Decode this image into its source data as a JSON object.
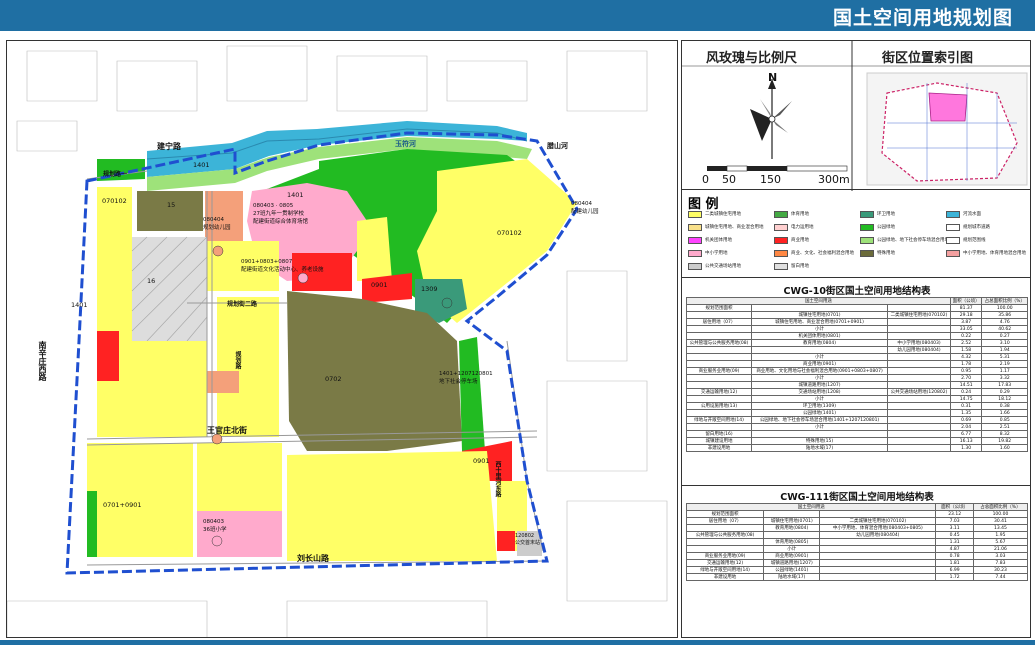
{
  "header": {
    "title": "国土空间用地规划图"
  },
  "panel": {
    "compass_title": "风玫瑰与比例尺",
    "index_title": "街区位置索引图",
    "north": "N",
    "scale_ticks": [
      "0",
      "50",
      "150",
      "300m"
    ],
    "legend_title": "图 例"
  },
  "legend": [
    {
      "label": "二类城镇住宅用地",
      "color": "#ffff66"
    },
    {
      "label": "体育用地",
      "color": "#44aa44"
    },
    {
      "label": "环卫用地",
      "color": "#3a9a7a"
    },
    {
      "label": "河流水面",
      "color": "#3cb4d8"
    },
    {
      "label": "城镇住宅用地、商业混合用地",
      "color": "#f8e08a"
    },
    {
      "label": "电力运用地",
      "color": "#ffd0d0"
    },
    {
      "label": "公园绿地",
      "color": "#22bb22"
    },
    {
      "label": "规划城市道路",
      "color": "#ffffff"
    },
    {
      "label": "机关团体用地",
      "color": "#ff44ff"
    },
    {
      "label": "商业用地",
      "color": "#ff2222"
    },
    {
      "label": "公园绿地、地下社会停车场混合用地",
      "color": "#9ee27a"
    },
    {
      "label": "规划范围线",
      "color": "#ffffff"
    },
    {
      "label": "中小学用地",
      "color": "#ffaacc"
    },
    {
      "label": "商业、文化、社会福利混合用地",
      "color": "#ff8844"
    },
    {
      "label": "特殊用地",
      "color": "#6b6b3a"
    },
    {
      "label": "中小学用地、体育用地混合用地",
      "color": "#f4a0a0"
    },
    {
      "label": "公共交通场站用地",
      "color": "#cccccc"
    },
    {
      "label": "留白用地",
      "color": "#e0e0e0"
    }
  ],
  "table1": {
    "title": "CWG-10街区国土空间用地结构表",
    "headers": [
      "国土空间用途",
      "面积（公顷）",
      "占总面积比例（%）"
    ],
    "rows": [
      [
        "规划范围面积",
        "",
        "",
        "81.37",
        "100.00"
      ],
      [
        "",
        "城镇住宅用地(0701)",
        "二类城镇住宅用地(070102)",
        "29.18",
        "35.86"
      ],
      [
        "居住用地（07）",
        "城镇住宅用地、商业混合用地(0701+0901)",
        "",
        "3.87",
        "4.76"
      ],
      [
        "",
        "小计",
        "",
        "33.05",
        "40.62"
      ],
      [
        "",
        "机关团体用地(0801)",
        "",
        "0.22",
        "0.27"
      ],
      [
        "公共管理与公共服务用地(08)",
        "教育用地(0804)",
        "中小学用地(080403)",
        "2.52",
        "3.10"
      ],
      [
        "",
        "",
        "幼儿园用地(080404)",
        "1.58",
        "1.94"
      ],
      [
        "",
        "小计",
        "",
        "4.32",
        "5.31"
      ],
      [
        "",
        "商业用地(0901)",
        "",
        "1.78",
        "2.19"
      ],
      [
        "商业服务业用地(09)",
        "商业用地、文化用地与社会福利混合用地(0901+0803+0807)",
        "",
        "0.95",
        "1.17"
      ],
      [
        "",
        "小计",
        "",
        "2.70",
        "3.32"
      ],
      [
        "",
        "城镇道路用地(1207)",
        "",
        "14.51",
        "17.83"
      ],
      [
        "交通运输用地(12)",
        "交通场站用地(1208)",
        "公共交通场站用地(120802)",
        "0.24",
        "0.29"
      ],
      [
        "",
        "小计",
        "",
        "14.75",
        "18.12"
      ],
      [
        "公用设施用地(13)",
        "环卫用地(1309)",
        "",
        "0.31",
        "0.38"
      ],
      [
        "",
        "公园绿地(1401)",
        "",
        "1.35",
        "1.66"
      ],
      [
        "绿地与开敞空间用地(14)",
        "公园绿地、地下社会停车场混合用地(1401+1207120801)",
        "",
        "0.69",
        "0.85"
      ],
      [
        "",
        "小计",
        "",
        "2.04",
        "2.51"
      ],
      [
        "留白用地(16)",
        "",
        "",
        "6.77",
        "8.32"
      ],
      [
        "城镇建设用地",
        "特殊用地(15)",
        "",
        "16.13",
        "19.82"
      ],
      [
        "非建设用地",
        "陆地水域(17)",
        "",
        "1.30",
        "1.60"
      ]
    ]
  },
  "table2": {
    "title": "CWG-111街区国土空间用地结构表",
    "headers": [
      "国土空间用途",
      "面积（公顷）",
      "占总面积比例（%）"
    ],
    "rows": [
      [
        "规划范围面积",
        "",
        "",
        "23.12",
        "100.00"
      ],
      [
        "居住用地（07）",
        "城镇住宅用地(0701)",
        "二类城镇住宅用地(070102)",
        "7.03",
        "30.41"
      ],
      [
        "",
        "教育用地(0804)",
        "中小学用地、体育混合用地(080403+0805)",
        "3.11",
        "13.45"
      ],
      [
        "公共管理与公共服务用地(08)",
        "",
        "幼儿园用地(080404)",
        "0.45",
        "1.95"
      ],
      [
        "",
        "体育用地(0805)",
        "",
        "1.31",
        "5.67"
      ],
      [
        "",
        "小计",
        "",
        "4.87",
        "21.06"
      ],
      [
        "商业服务业用地(09)",
        "商业用地(0901)",
        "",
        "0.78",
        "3.03"
      ],
      [
        "交通运输用地(12)",
        "城镇道路用地(1207)",
        "",
        "1.81",
        "7.83"
      ],
      [
        "绿地与开敞空间用地(14)",
        "公园绿地(1401)",
        "",
        "6.99",
        "30.23"
      ],
      [
        "非建设用地",
        "陆地水域(17)",
        "",
        "1.72",
        "7.44"
      ]
    ]
  },
  "roads": {
    "r1": "建宁路",
    "r2": "规划路一",
    "r3": "规划街二路",
    "r4": "王官庄北街",
    "r5": "刘长山路",
    "r6": "南辛庄西路",
    "r7": "玉符河",
    "r8": "腊山河",
    "r9": "规划路",
    "r10": "西十里河东路"
  },
  "plots": {
    "p1": "070102",
    "p2": "080404\n规划幼儿园",
    "p3": "1401",
    "p4": "15",
    "p5": "16",
    "p6": "080403 · 0805\n27班九年一贯制学校\n配建街道综合体育场馆",
    "p7": "0901+0803+0807\n配建街道文化活动中心、养老设施",
    "p8": "0901",
    "p9": "1309",
    "p10": "070102",
    "p11": "080404\n配建幼儿园",
    "p12": "1401+1207120801\n地下社会停车场",
    "p13": "0701+0901",
    "p14": "080403\n36班小学",
    "p15": "120802\n公交首末站",
    "p16": "1401",
    "p17": "1401",
    "p18": "0901",
    "p19": "0702"
  },
  "colors": {
    "residential": "#ffff66",
    "park": "#22bb22",
    "park_light": "#9ee27a",
    "water": "#3cb4d8",
    "school": "#ffaacc",
    "commercial": "#ff2222",
    "special": "#7a7a46",
    "reserve": "#e8e8e8",
    "mixed_res": "#f0e68c",
    "boundary": "#1f4fd0",
    "kinder": "#f4a07a",
    "sanitation": "#3a9a7a",
    "header": "#1f6fa3"
  }
}
